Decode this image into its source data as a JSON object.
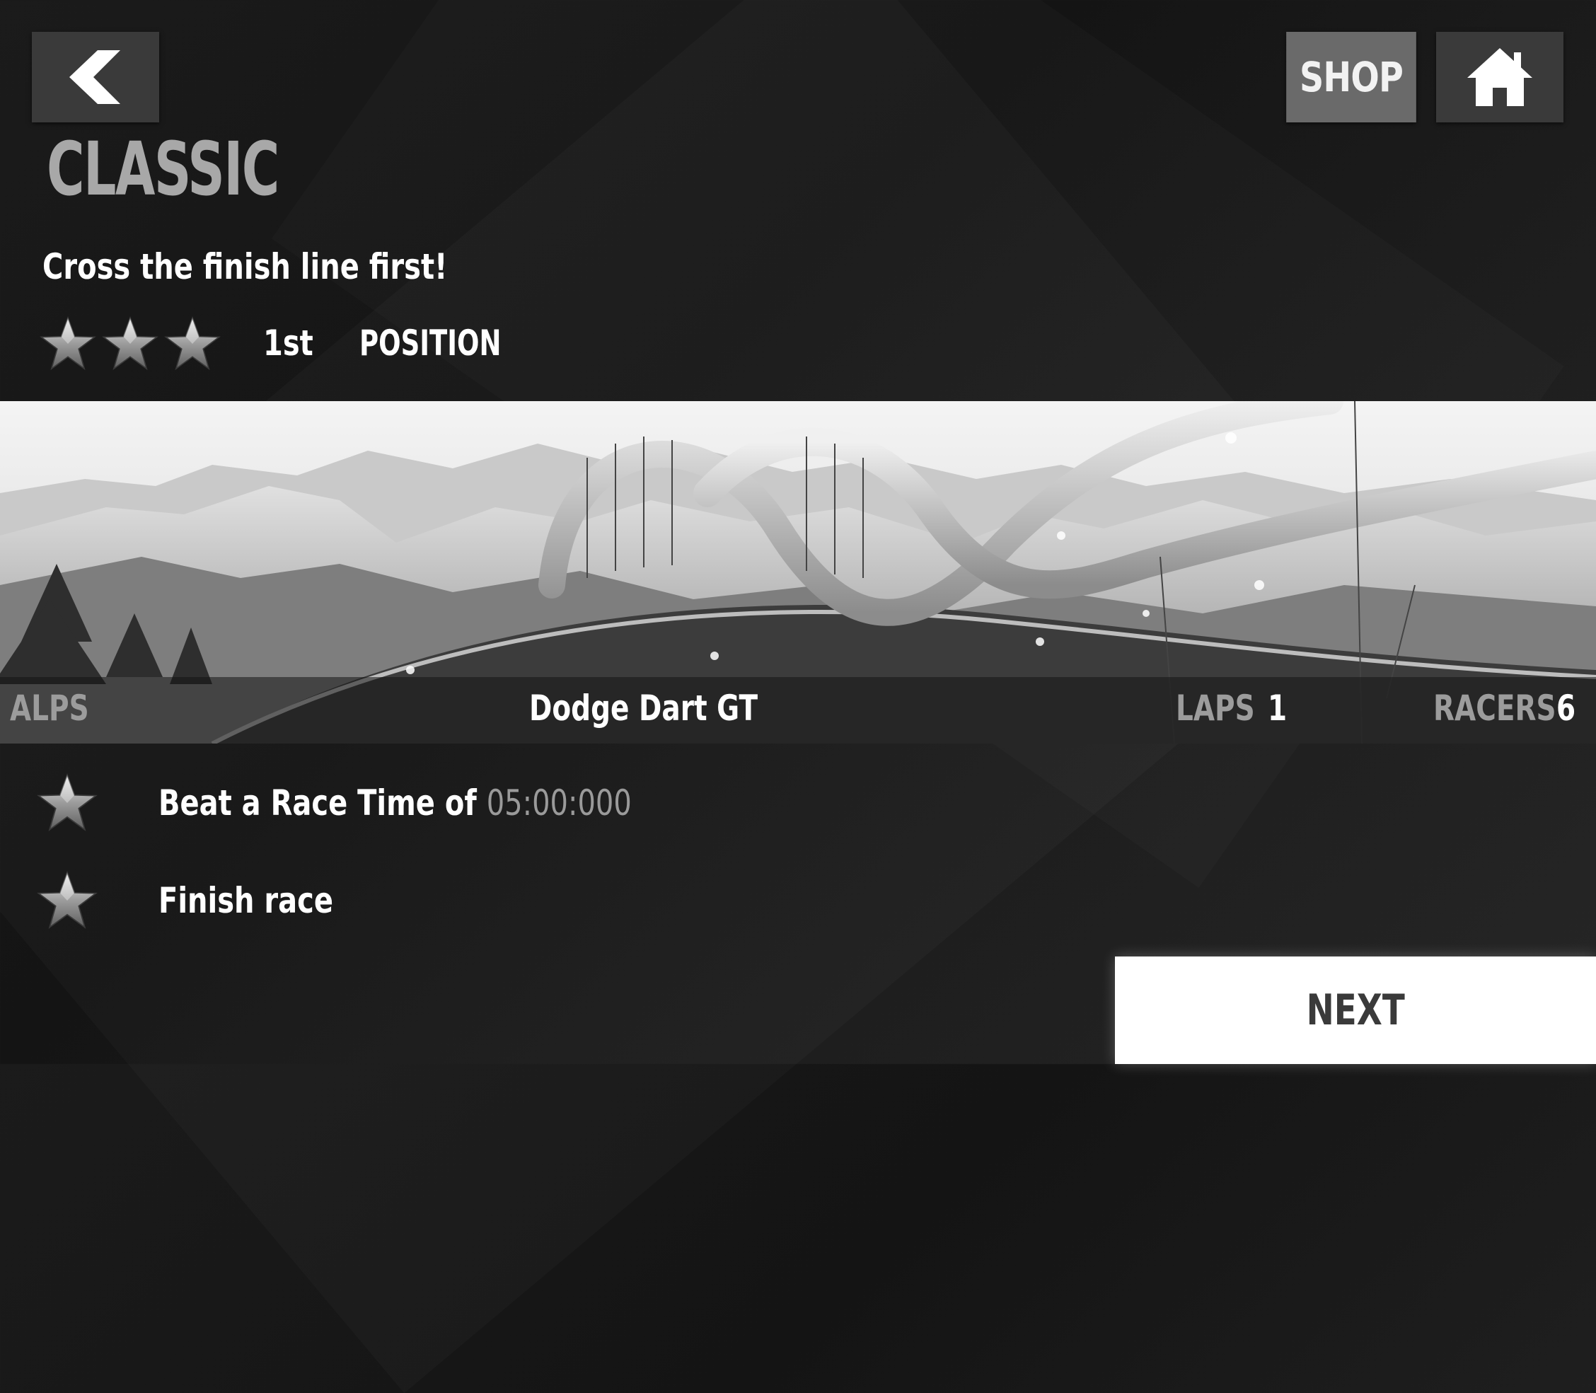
{
  "header": {
    "shop_label": "SHOP",
    "back_icon": "chevron-left-icon",
    "home_icon": "home-icon"
  },
  "mode": {
    "title": "CLASSIC",
    "objective": "Cross the finish line first!",
    "stars_earned": 3,
    "position_value": "1st",
    "position_label": "POSITION"
  },
  "track": {
    "location": "ALPS",
    "car": "Dodge Dart GT",
    "laps_label": "LAPS",
    "laps_value": "1",
    "racers_label": "RACERS",
    "racers_value": "6"
  },
  "objectives": [
    {
      "text": "Beat a Race Time of",
      "value": "05:00:000",
      "icon": "star-icon"
    },
    {
      "text": "Finish race",
      "icon": "star-icon"
    }
  ],
  "next_label": "NEXT",
  "colors": {
    "background": "#1b1b1b",
    "title_gray": "#a8a8a8",
    "shop_button": "#6a6a6a",
    "button_dark": "#3a3a3a",
    "next_button": "#ffffff"
  }
}
